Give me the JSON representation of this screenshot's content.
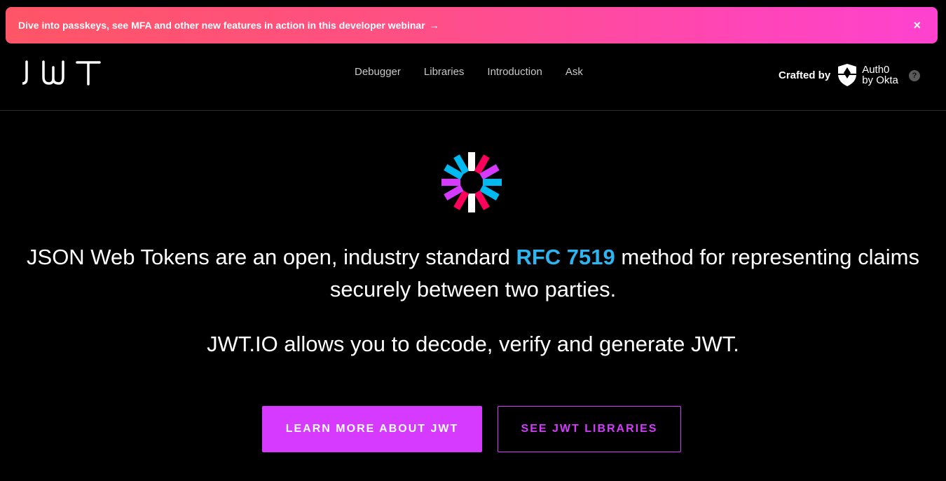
{
  "banner": {
    "text": "Dive into passkeys, see MFA and other new features in action in this developer webinar",
    "arrow": "→",
    "close": "×"
  },
  "header": {
    "logo_text": "JWT",
    "nav": [
      "Debugger",
      "Libraries",
      "Introduction",
      "Ask"
    ],
    "crafted_by": "Crafted by",
    "auth0_line1": "Auth0",
    "auth0_line2": "by Okta",
    "help": "?"
  },
  "hero": {
    "headline_before": "JSON Web Tokens are an open, industry standard ",
    "headline_link": "RFC 7519",
    "headline_after": " method for representing claims securely between two parties.",
    "subline": "JWT.IO allows you to decode, verify and generate JWT.",
    "primary_button": "LEARN MORE ABOUT JWT",
    "secondary_button": "SEE JWT LIBRARIES"
  },
  "colors": {
    "accent_purple": "#d63aff",
    "link_blue": "#2eb5f0",
    "logo_pink": "#fb015b",
    "logo_cyan": "#00b9f1",
    "logo_violet": "#d63aff",
    "logo_white": "#ffffff"
  }
}
